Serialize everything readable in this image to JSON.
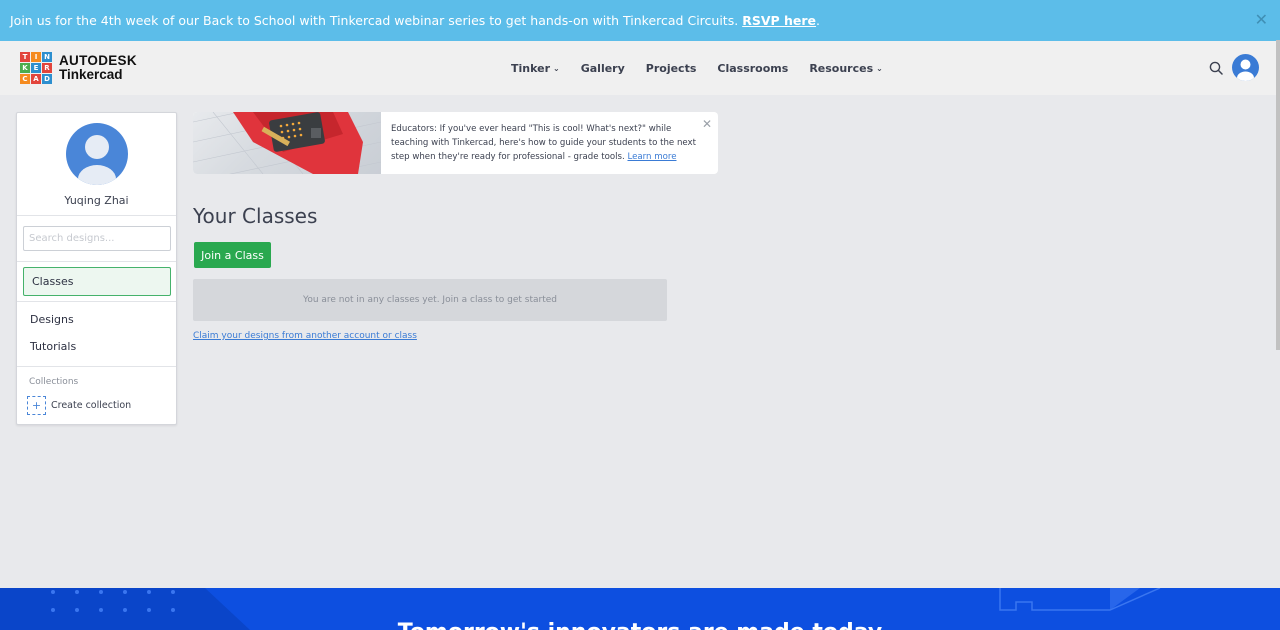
{
  "banner": {
    "text": "Join us for the 4th week of our Back to School with Tinkercad webinar series to get hands-on with Tinkercad Circuits.",
    "link": "RSVP here",
    "end": ".",
    "close": "✕"
  },
  "logo": {
    "letters": [
      "T",
      "I",
      "N",
      "K",
      "E",
      "R",
      "C",
      "A",
      "D"
    ],
    "brand": "AUTODESK",
    "product": "Tinkercad"
  },
  "nav": {
    "items": [
      {
        "label": "Tinker",
        "dropdown": true
      },
      {
        "label": "Gallery",
        "dropdown": false
      },
      {
        "label": "Projects",
        "dropdown": false
      },
      {
        "label": "Classrooms",
        "dropdown": false
      },
      {
        "label": "Resources",
        "dropdown": true
      }
    ],
    "chevron": "⌄"
  },
  "sidebar": {
    "username": "Yuqing Zhai",
    "search_placeholder": "Search designs...",
    "active_item": "Classes",
    "links": [
      "Designs",
      "Tutorials"
    ],
    "collections_label": "Collections",
    "create_collection": "Create collection",
    "plus": "+"
  },
  "promo": {
    "text": "Educators: If you've ever heard \"This is cool! What's next?\" while teaching with Tinkercad, here's how to guide your students to the next step when they're ready for professional - grade tools.",
    "link": "Learn more",
    "close": "✕"
  },
  "main": {
    "title": "Your Classes",
    "join_button": "Join a Class",
    "empty_message": "You are not in any classes yet. Join a class to get started",
    "claim_link": "Claim your designs from another account or class"
  },
  "footer": {
    "headline": "Tomorrow's innovators are made today"
  },
  "colors": {
    "banner": "#5cbde9",
    "accent_green": "#29a84f",
    "link_blue": "#3a7bd5",
    "footer_blue": "#0d4fe0"
  }
}
